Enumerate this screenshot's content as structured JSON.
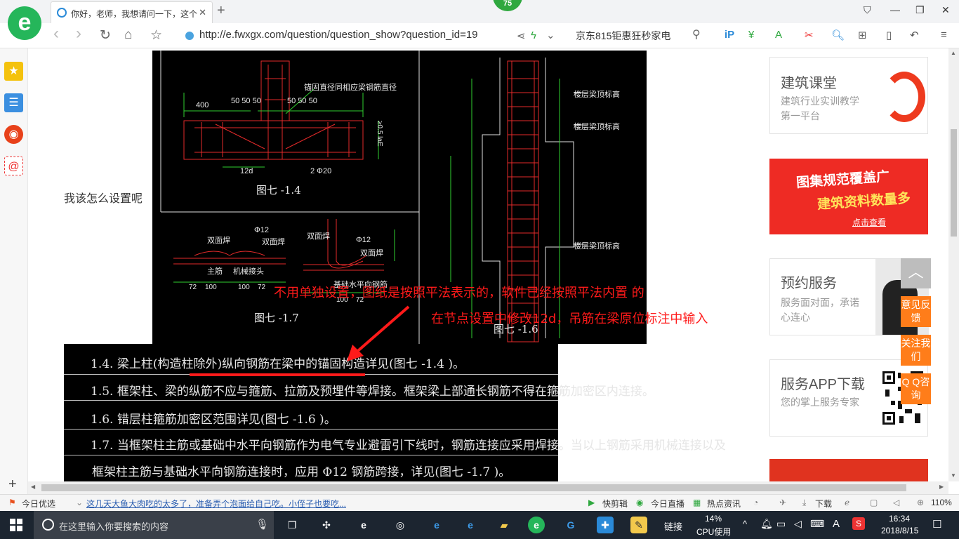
{
  "browser": {
    "tab_title": "你好，老师，我想请问一下，这个",
    "badge": "75",
    "url": "http://e.fwxgx.com/question/question_show?question_id=19",
    "search_hint": "京东815钜惠狂秒家电",
    "back": "‹",
    "forward": "›",
    "reload": "↻",
    "home": "⌂",
    "star": "☆",
    "new_tab": "+",
    "close": "✕"
  },
  "page": {
    "question_text": "我该怎么设置呢",
    "answer_line1": "不用单独设置，图纸是按照平法表示的，软件已经按照平法内置 的",
    "answer_line2": "在节点设置中修改12d，吊筋在梁原位标注中输入"
  },
  "cad": {
    "fig14": "图七 -1.4",
    "fig17": "图七 -1.7",
    "fig16": "图七 -1.6",
    "label_anchor": "锚固直径同相应梁钢筋直径",
    "dims_top": [
      "400",
      "50 50 50",
      "50 50 50"
    ],
    "dim_12d": "12d",
    "dim_2phi20": "2 Φ20",
    "dim_laE": "≥0.5 laE",
    "label_floor": "楼层梁顶标高",
    "phi12": "Φ12",
    "label_dbh": "双面焊",
    "label_main": "主筋",
    "label_mech": "机械接头",
    "label_foot": "基础水平向钢筋",
    "dims_bottom": [
      "72",
      "100",
      "100",
      "72",
      "100",
      "72"
    ],
    "spec_lines": [
      "1.4.    梁上柱(构造柱除外)纵向钢筋在梁中的锚固构造详见(图七          -1.4    )。",
      "1.5.    框架柱、梁的纵筋不应与箍筋、拉筋及预埋件等焊接。框架梁上部通长钢筋不得在箍筋加密区内连接。",
      "1.6.    错层柱箍筋加密区范围详见(图七        -1.6     )。",
      "1.7.    当框架柱主筋或基础中水平向钢筋作为电气专业避雷引下线时，钢筋连接应采用焊接。当以上钢筋采用机械连接以及",
      "框架柱主筋与基础水平向钢筋连接时，应用            Φ12    钢筋跨接，详见(图七        -1.7     )。"
    ]
  },
  "ads": {
    "course_title": "建筑课堂",
    "course_sub": "建筑行业实训教学第一平台",
    "banner_l1": "图集规范覆盖广",
    "banner_l2": "建筑资料数量多",
    "banner_btn": "点击查看",
    "service_title": "预约服务",
    "service_sub": "服务面对面，承诺心连心",
    "app_title": "服务APP下载",
    "app_sub": "您的掌上服务专家"
  },
  "floating": {
    "feedback": "意见反馈",
    "follow": "关注我们",
    "qq": "Q Q咨询",
    "totop": "︿"
  },
  "statusbar": {
    "pick": "今日优选",
    "news": "这几天大鱼大肉吃的太多了，准备弄个泡面给自己吃。小侄子也要吃...",
    "kuaijianji": "快剪辑",
    "live": "今日直播",
    "hot": "热点资讯",
    "download": "下载",
    "zoom": "110%"
  },
  "taskbar": {
    "search_placeholder": "在这里输入你要搜索的内容",
    "link": "链接",
    "cpu_pct": "14%",
    "cpu_label": "CPU使用",
    "ime": "A",
    "time": "16:34",
    "date": "2018/8/15"
  },
  "colors": {
    "annotation_red": "#ff1a1a",
    "brand_green": "#25b65a",
    "float_orange": "#ff7d1a",
    "taskbar": "#1c2530"
  }
}
